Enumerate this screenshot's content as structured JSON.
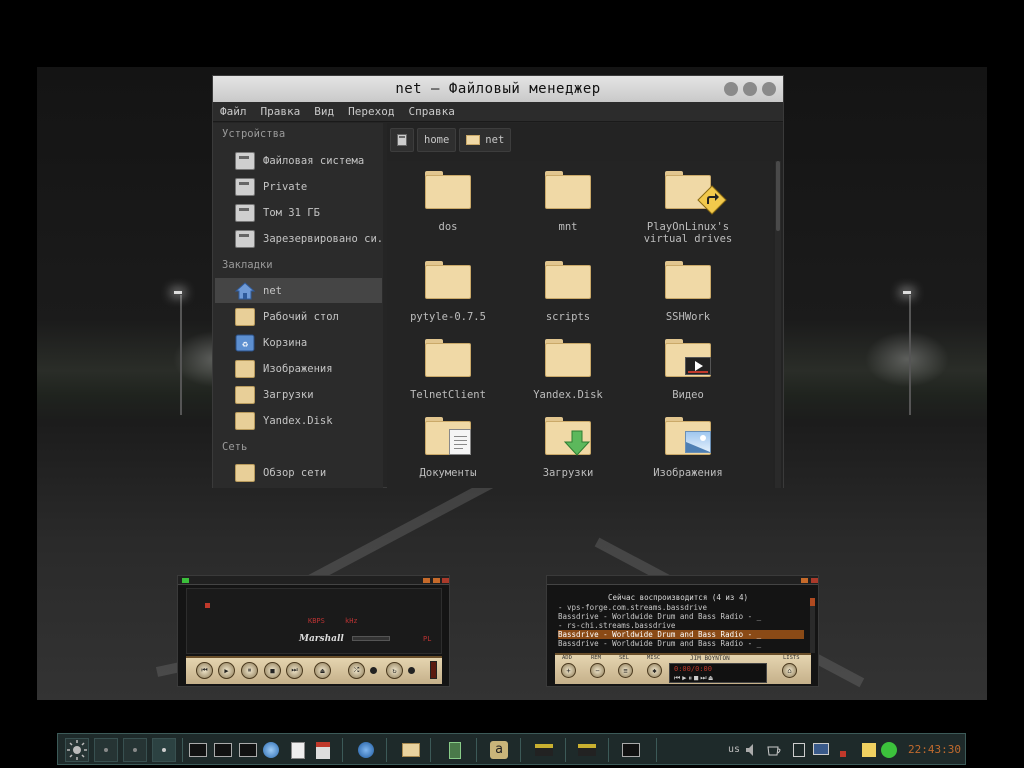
{
  "window": {
    "title": "net – Файловый менеджер",
    "menu": [
      "Файл",
      "Правка",
      "Вид",
      "Переход",
      "Справка"
    ]
  },
  "sidebar": {
    "devices_heading": "Устройства",
    "devices": [
      {
        "label": "Файловая система",
        "icon": "drive-icon"
      },
      {
        "label": "Private",
        "icon": "drive-icon"
      },
      {
        "label": "Том 31 ГБ",
        "icon": "drive-icon"
      },
      {
        "label": "Зарезервировано си...",
        "icon": "drive-icon"
      }
    ],
    "bookmarks_heading": "Закладки",
    "bookmarks": [
      {
        "label": "net",
        "icon": "home-icon",
        "active": true
      },
      {
        "label": "Рабочий стол",
        "icon": "desktop-folder-icon"
      },
      {
        "label": "Корзина",
        "icon": "trash-icon"
      },
      {
        "label": "Изображения",
        "icon": "pictures-folder-icon"
      },
      {
        "label": "Загрузки",
        "icon": "downloads-folder-icon"
      },
      {
        "label": "Yandex.Disk",
        "icon": "folder-icon"
      }
    ],
    "network_heading": "Сеть",
    "network": [
      {
        "label": "Обзор сети",
        "icon": "network-icon"
      }
    ]
  },
  "path": [
    "home",
    "net"
  ],
  "files": [
    {
      "label": "dos",
      "icon": "folder-icon"
    },
    {
      "label": "mnt",
      "icon": "folder-icon"
    },
    {
      "label": "PlayOnLinux's\nvirtual drives",
      "icon": "folder-link-icon"
    },
    {
      "label": "pytyle-0.7.5",
      "icon": "folder-icon"
    },
    {
      "label": "scripts",
      "icon": "folder-icon"
    },
    {
      "label": "SSHWork",
      "icon": "folder-icon"
    },
    {
      "label": "TelnetClient",
      "icon": "folder-icon"
    },
    {
      "label": "Yandex.Disk",
      "icon": "folder-icon"
    },
    {
      "label": "Видео",
      "icon": "video-folder-icon"
    },
    {
      "label": "Документы",
      "icon": "documents-folder-icon"
    },
    {
      "label": "Загрузки",
      "icon": "downloads-folder-icon"
    },
    {
      "label": "Изображения",
      "icon": "pictures-folder-icon"
    }
  ],
  "player": {
    "kbps": "KBPS",
    "khz": "kHz",
    "brand": "Marshall",
    "pl_badge": "PL"
  },
  "playlist": {
    "heading": "Сейчас воспроизводится (4 из 4)",
    "rows": [
      {
        "text": "- vps-forge.com.streams.bassdrive",
        "selected": false
      },
      {
        "text": "Bassdrive - Worldwide Drum and Bass Radio -  _",
        "selected": false
      },
      {
        "text": "- rs-chi.streams.bassdrive",
        "selected": false
      },
      {
        "text": "Bassdrive - Worldwide Drum and Bass Radio -  _",
        "selected": true
      },
      {
        "text": "Bassdrive - Worldwide Drum and Bass Radio -  _",
        "selected": false
      }
    ],
    "buttons": [
      "ADD",
      "REM",
      "SEL",
      "MISC",
      "LISTS"
    ],
    "brand": "JIM BOYNTON",
    "time": "0:00/0:00"
  },
  "taskbar": {
    "keyboard_layout": "us",
    "clock": "22:43:30"
  },
  "colors": {
    "accent_orange": "#c06a2e",
    "folder": "#f0d9a6",
    "taskbar_border": "#3c5a58"
  }
}
